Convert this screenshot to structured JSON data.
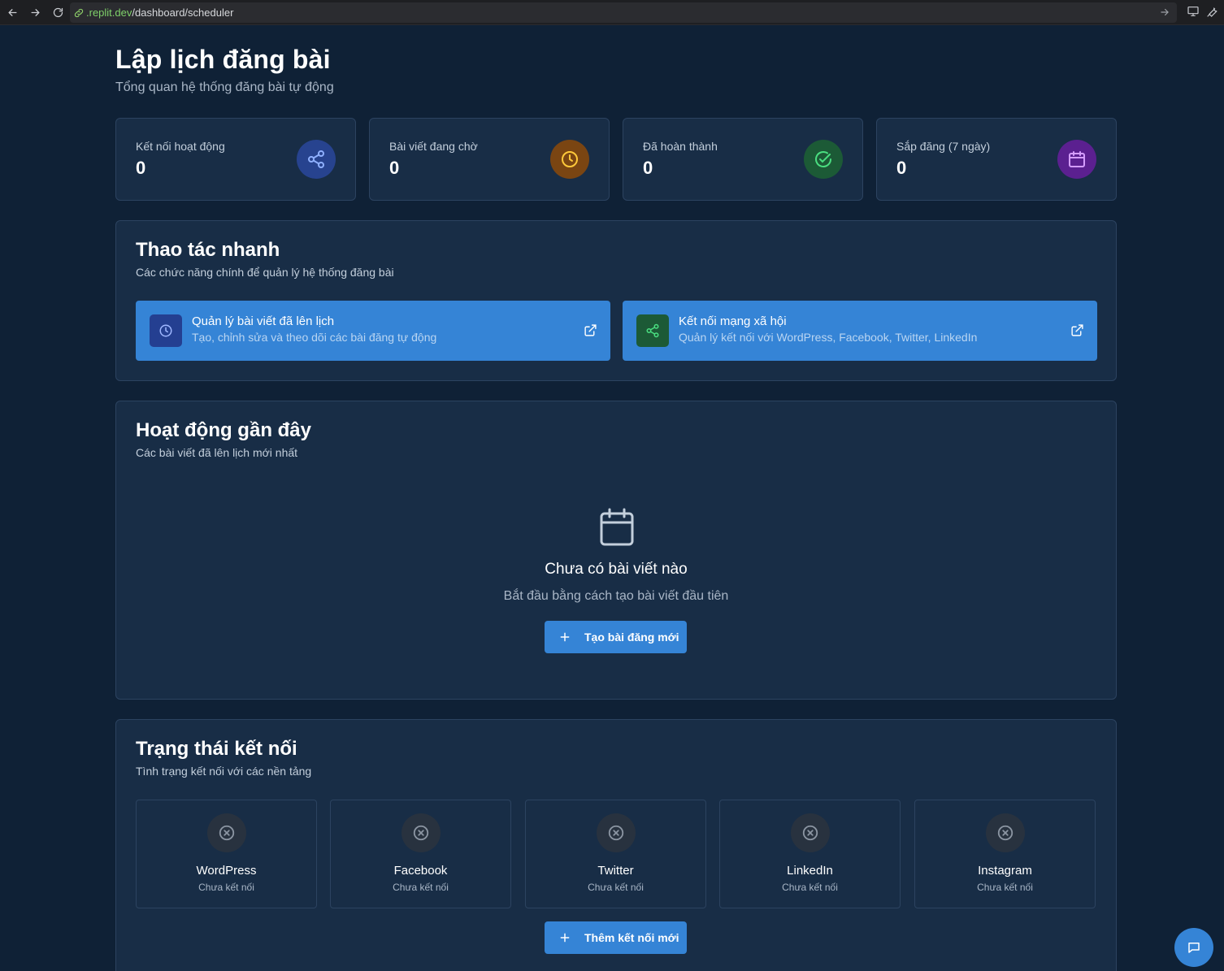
{
  "browser": {
    "url_host": ".replit.dev",
    "url_path": "/dashboard/scheduler"
  },
  "header": {
    "title": "Lập lịch đăng bài",
    "subtitle": "Tổng quan hệ thống đăng bài tự động"
  },
  "stats": [
    {
      "label": "Kết nối hoạt động",
      "value": "0",
      "icon": "share-icon",
      "color": "#27438f"
    },
    {
      "label": "Bài viết đang chờ",
      "value": "0",
      "icon": "clock-icon",
      "color": "#7a4512"
    },
    {
      "label": "Đã hoàn thành",
      "value": "0",
      "icon": "check-circle-icon",
      "color": "#1c5a36"
    },
    {
      "label": "Sắp đăng (7 ngày)",
      "value": "0",
      "icon": "calendar-icon",
      "color": "#5b2090"
    }
  ],
  "quick": {
    "title": "Thao tác nhanh",
    "subtitle": "Các chức năng chính để quản lý hệ thống đăng bài",
    "actions": [
      {
        "title": "Quản lý bài viết đã lên lịch",
        "desc": "Tạo, chỉnh sửa và theo dõi các bài đăng tự động",
        "icon": "clock-icon"
      },
      {
        "title": "Kết nối mạng xã hội",
        "desc": "Quản lý kết nối với WordPress, Facebook, Twitter, LinkedIn",
        "icon": "share-icon"
      }
    ]
  },
  "recent": {
    "title": "Hoạt động gần đây",
    "subtitle": "Các bài viết đã lên lịch mới nhất",
    "empty_title": "Chưa có bài viết nào",
    "empty_sub": "Bắt đầu bằng cách tạo bài viết đầu tiên",
    "button": "Tạo bài đăng mới"
  },
  "connections": {
    "title": "Trạng thái kết nối",
    "subtitle": "Tình trạng kết nối với các nền tảng",
    "items": [
      {
        "name": "WordPress",
        "status": "Chưa kết nối"
      },
      {
        "name": "Facebook",
        "status": "Chưa kết nối"
      },
      {
        "name": "Twitter",
        "status": "Chưa kết nối"
      },
      {
        "name": "LinkedIn",
        "status": "Chưa kết nối"
      },
      {
        "name": "Instagram",
        "status": "Chưa kết nối"
      }
    ],
    "button": "Thêm kết nối mới"
  }
}
